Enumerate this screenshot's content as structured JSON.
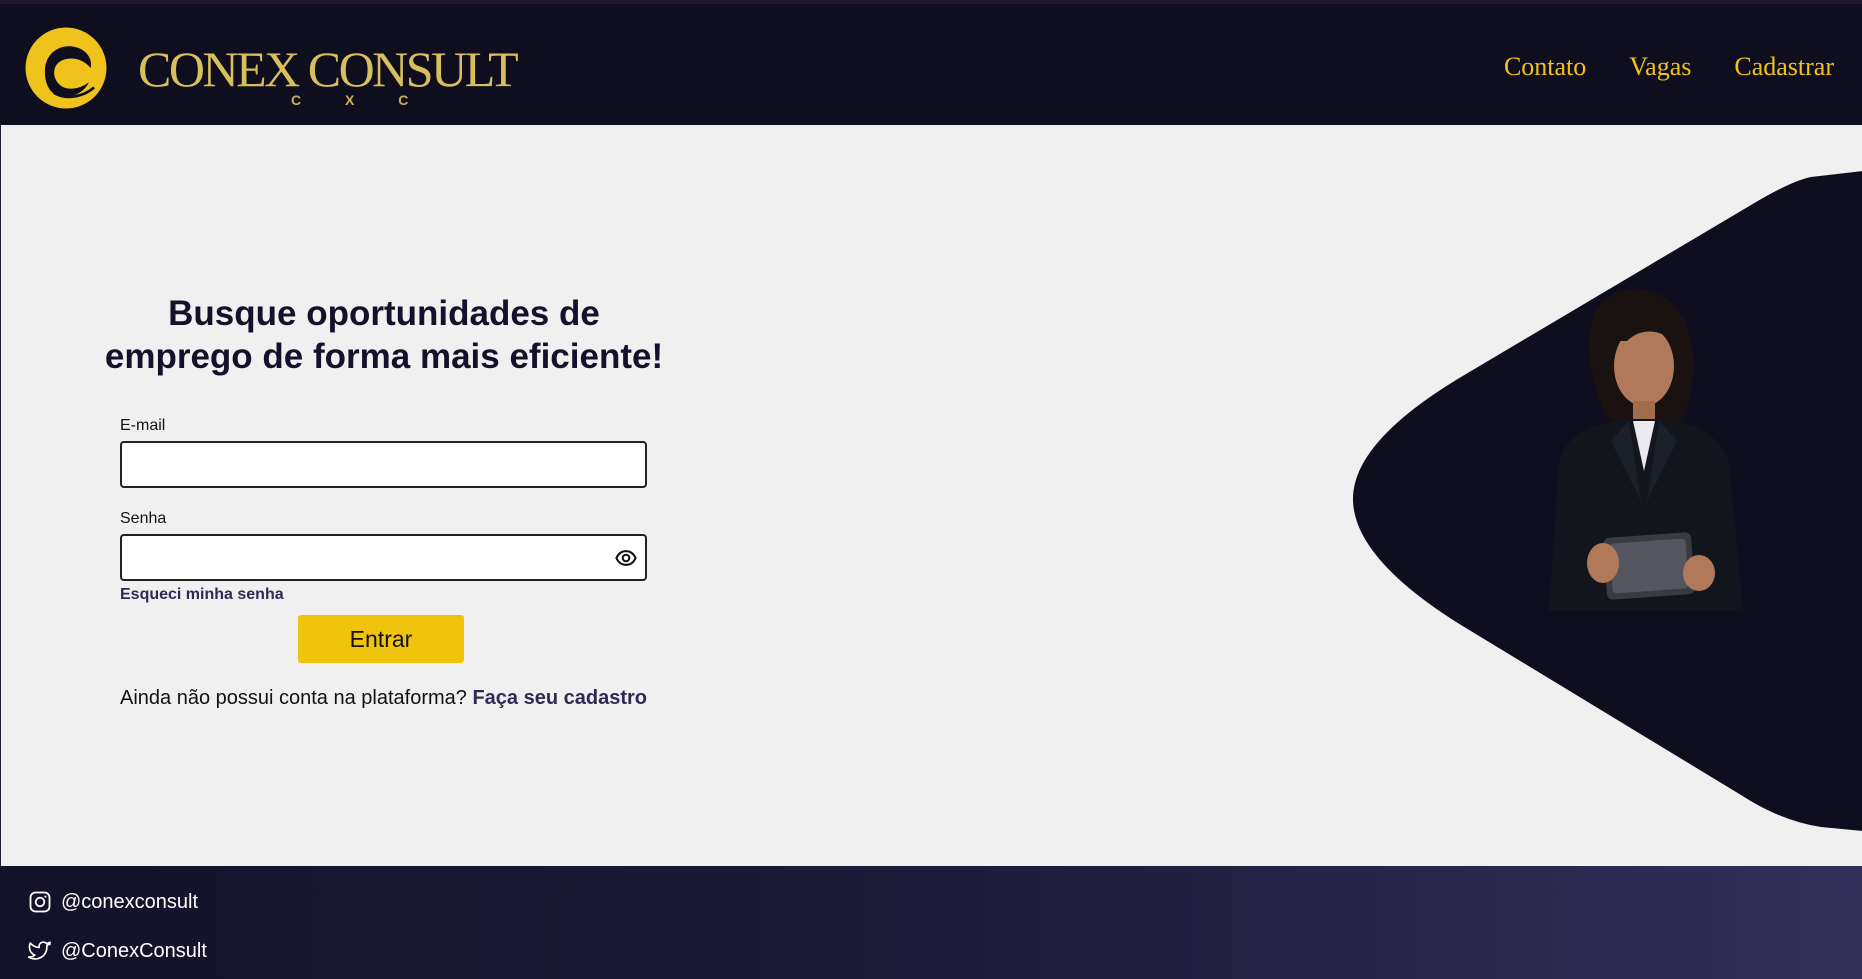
{
  "brand": {
    "name": "CONEX CONSULT",
    "subtitle": "C X C",
    "logo_icon": "conex-logo-mark",
    "gold": "#f0c31c"
  },
  "nav": {
    "items": [
      {
        "label": "Contato"
      },
      {
        "label": "Vagas"
      },
      {
        "label": "Cadastrar"
      }
    ]
  },
  "login": {
    "headline_line1": "Busque oportunidades de",
    "headline_line2": "emprego de forma mais eficiente!",
    "email_label": "E-mail",
    "email_value": "",
    "password_label": "Senha",
    "password_value": "",
    "password_toggle_icon": "eye-icon",
    "forgot_label": "Esqueci minha senha",
    "submit_label": "Entrar",
    "signup_prompt": "Ainda não possui conta na plataforma?",
    "signup_link": "Faça seu cadastro",
    "accent": "#f0c40a"
  },
  "hero": {
    "shape_color": "#0f0e1e",
    "image_subject": "businesswoman-with-tablet"
  },
  "footer": {
    "socials": [
      {
        "icon": "instagram-icon",
        "handle": "@conexconsult"
      },
      {
        "icon": "twitter-icon",
        "handle": "@ConexConsult"
      }
    ]
  }
}
